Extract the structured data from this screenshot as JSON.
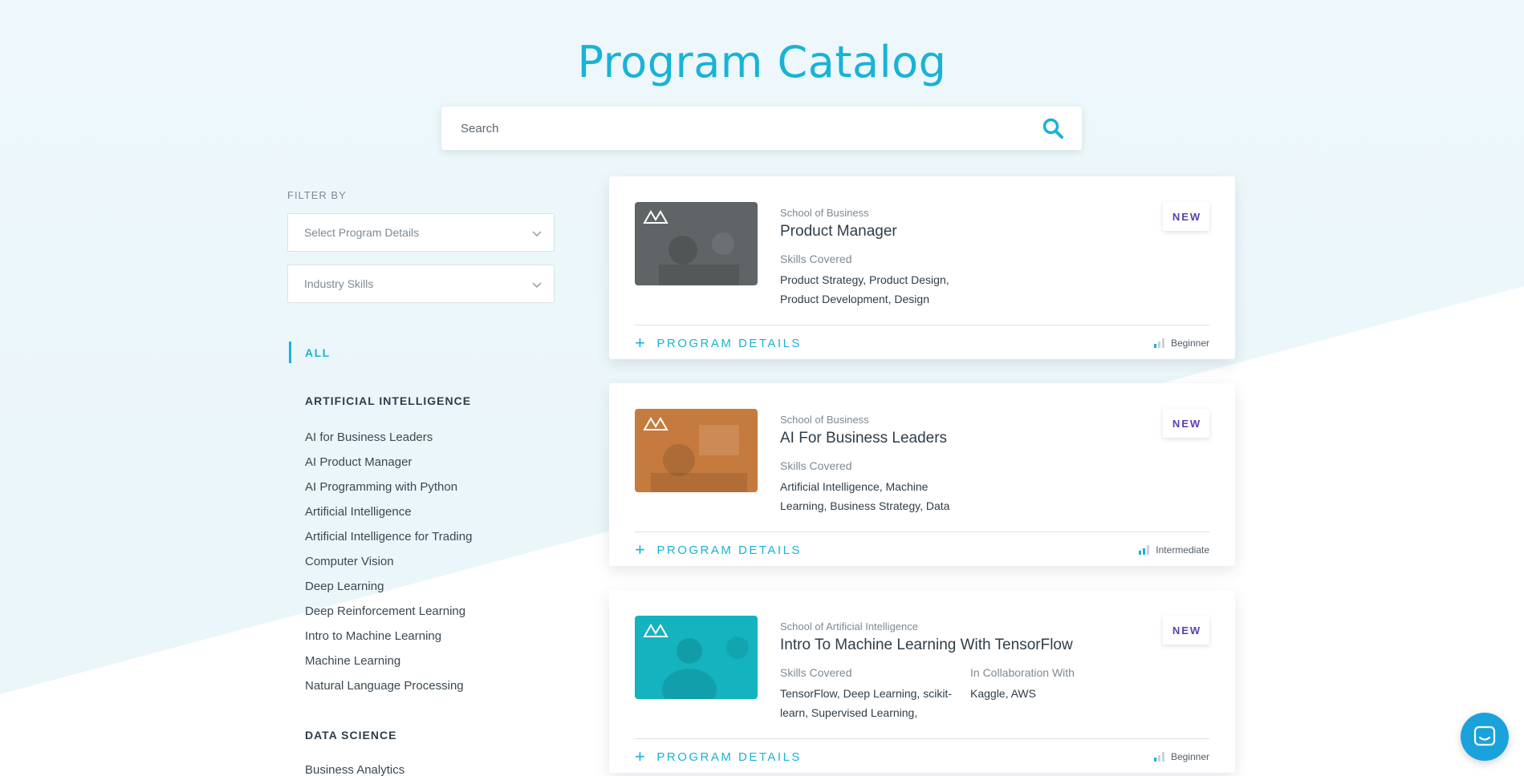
{
  "header": {
    "title": "Program Catalog"
  },
  "search": {
    "placeholder": "Search"
  },
  "filters": {
    "label": "FILTER BY",
    "program_details": "Select Program Details",
    "industry_skills": "Industry Skills"
  },
  "categories": {
    "all": "ALL",
    "groups": [
      {
        "heading": "ARTIFICIAL INTELLIGENCE",
        "items": [
          "AI for Business Leaders",
          "AI Product Manager",
          "AI Programming with Python",
          "Artificial Intelligence",
          "Artificial Intelligence for Trading",
          "Computer Vision",
          "Deep Learning",
          "Deep Reinforcement Learning",
          "Intro to Machine Learning",
          "Machine Learning",
          "Natural Language Processing"
        ]
      },
      {
        "heading": "DATA SCIENCE",
        "items": [
          "Business Analytics"
        ]
      }
    ]
  },
  "programs": [
    {
      "school": "School of Business",
      "title": "Product Manager",
      "skills_label": "Skills Covered",
      "skills": "Product Strategy, Product Design, Product Development, Design",
      "badge": "NEW",
      "details_label": "PROGRAM DETAILS",
      "level": "Beginner",
      "level_value": 1,
      "thumb_color": "#5f6566"
    },
    {
      "school": "School of Business",
      "title": "AI For Business Leaders",
      "skills_label": "Skills Covered",
      "skills": "Artificial Intelligence, Machine Learning, Business Strategy, Data",
      "badge": "NEW",
      "details_label": "PROGRAM DETAILS",
      "level": "Intermediate",
      "level_value": 2,
      "thumb_color": "#c57a3e"
    },
    {
      "school": "School of Artificial Intelligence",
      "title": "Intro To Machine Learning With TensorFlow",
      "skills_label": "Skills Covered",
      "skills": "TensorFlow, Deep Learning, scikit-learn, Supervised Learning,",
      "collab_label": "In Collaboration With",
      "collab": "Kaggle, AWS",
      "badge": "NEW",
      "details_label": "PROGRAM DETAILS",
      "level": "Beginner",
      "level_value": 1,
      "thumb_color": "#14b3bf"
    }
  ],
  "colors": {
    "accent": "#18b3d6",
    "badge_text": "#5b3fb1",
    "chat_button": "#1aa2dc"
  }
}
